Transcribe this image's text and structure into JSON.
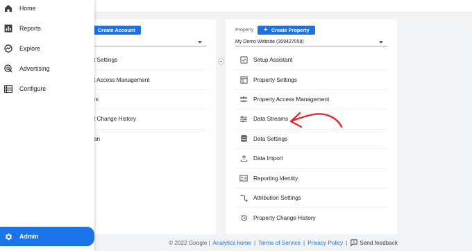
{
  "sidebar": {
    "items": [
      {
        "label": "Home",
        "icon": "home-icon"
      },
      {
        "label": "Reports",
        "icon": "reports-icon"
      },
      {
        "label": "Explore",
        "icon": "explore-icon"
      },
      {
        "label": "Advertising",
        "icon": "advertising-icon"
      },
      {
        "label": "Configure",
        "icon": "configure-icon"
      }
    ],
    "admin_label": "Admin"
  },
  "account": {
    "create_label": "Create Account",
    "items": [
      "t Settings",
      "t Access Management",
      "rs",
      "t Change History",
      "an"
    ]
  },
  "property": {
    "label": "Property",
    "create_label": "Create Property",
    "selected": "My Demo Website (309427058)",
    "items": [
      "Setup Assistant",
      "Property Settings",
      "Property Access Management",
      "Data Streams",
      "Data Settings",
      "Data Import",
      "Reporting Identity",
      "Attribution Settings",
      "Property Change History"
    ]
  },
  "footer": {
    "copyright": "© 2022 Google",
    "analytics_home": "Analytics home",
    "terms": "Terms of Service",
    "privacy": "Privacy Policy",
    "feedback": "Send feedback",
    "separator": "|"
  },
  "colors": {
    "accent": "#1a73e8",
    "annotation": "#e8252b"
  }
}
